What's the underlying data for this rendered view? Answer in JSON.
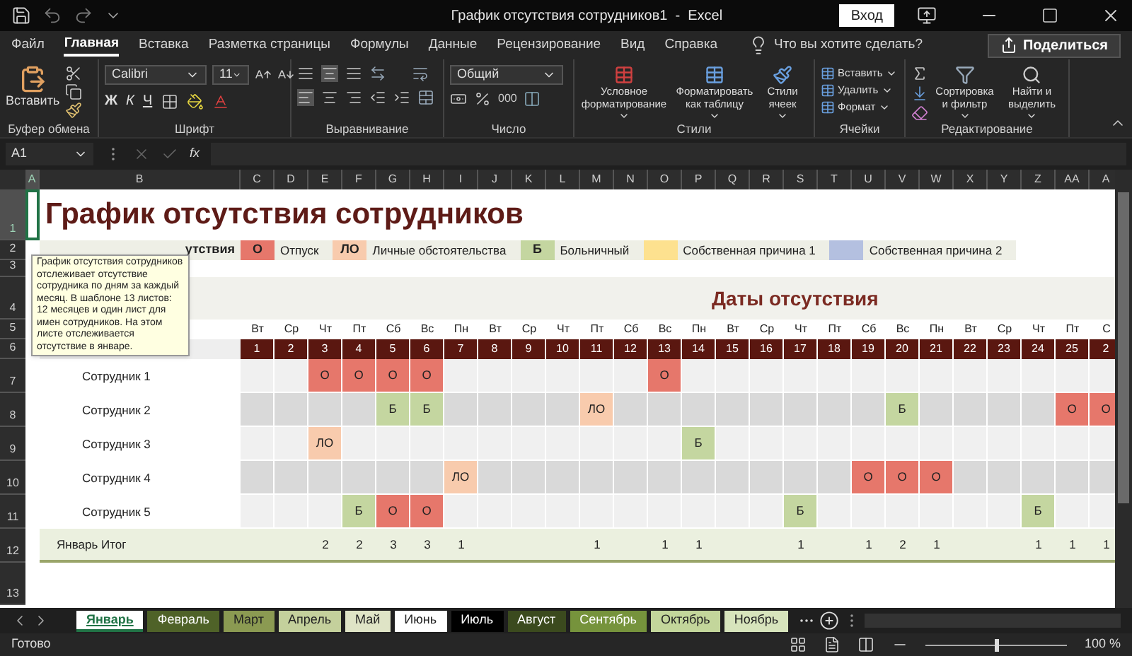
{
  "title_bar": {
    "title": "График отсутствия сотрудников1  -  Excel",
    "sign_in": "Вход"
  },
  "menu_tabs": [
    {
      "label": "Файл",
      "selected": false
    },
    {
      "label": "Главная",
      "selected": true
    },
    {
      "label": "Вставка",
      "selected": false
    },
    {
      "label": "Разметка страницы",
      "selected": false
    },
    {
      "label": "Формулы",
      "selected": false
    },
    {
      "label": "Данные",
      "selected": false
    },
    {
      "label": "Рецензирование",
      "selected": false
    },
    {
      "label": "Вид",
      "selected": false
    },
    {
      "label": "Справка",
      "selected": false
    }
  ],
  "tell_me": "Что вы хотите сделать?",
  "share": "Поделиться",
  "ribbon": {
    "clipboard": {
      "paste": "Вставить",
      "group": "Буфер обмена"
    },
    "font": {
      "name": "Calibri",
      "size": "11",
      "bold": "Ж",
      "italic": "К",
      "underline": "Ч",
      "group": "Шрифт"
    },
    "alignment": {
      "group": "Выравнивание"
    },
    "number": {
      "format": "Общий",
      "thousands": "000",
      "group": "Число"
    },
    "styles": {
      "buttons": [
        "Условное форматирование",
        "Форматировать как таблицу",
        "Стили ячеек"
      ],
      "group": "Стили"
    },
    "cells": {
      "buttons": [
        "Вставить",
        "Удалить",
        "Формат"
      ],
      "group": "Ячейки"
    },
    "editing": {
      "buttons": [
        "Сортировка и фильтр",
        "Найти и выделить"
      ],
      "group": "Редактирование"
    }
  },
  "formula_bar": {
    "cell": "A1",
    "function_label": "fx"
  },
  "columns": [
    "A",
    "B",
    "C",
    "D",
    "E",
    "F",
    "G",
    "H",
    "I",
    "J",
    "K",
    "L",
    "M",
    "N",
    "O",
    "P",
    "Q",
    "R",
    "S",
    "T",
    "U",
    "V",
    "W",
    "X",
    "Y",
    "Z",
    "AA",
    "A"
  ],
  "row_numbers": [
    "1",
    "2",
    "3",
    "4",
    "5",
    "6",
    "7",
    "8",
    "9",
    "10",
    "11",
    "12",
    "13"
  ],
  "sheet": {
    "title": "График отсутствия сотрудников",
    "legend_label": "утствия",
    "legend": [
      {
        "code": "О",
        "label": "Отпуск",
        "kind": "vacation",
        "color": "#e6776b"
      },
      {
        "code": "ЛО",
        "label": "Личные обстоятельства",
        "kind": "personal",
        "color": "#f8cbad"
      },
      {
        "code": "Б",
        "label": "Больничный",
        "kind": "sick",
        "color": "#c4d6a0"
      },
      {
        "label": "Собственная причина 1",
        "kind": "own1",
        "color": "#fde18f"
      },
      {
        "label": "Собственная причина 2",
        "kind": "own2",
        "color": "#b4c0e0"
      }
    ],
    "dates_heading": "Даты отсутствия",
    "days": [
      {
        "name": "Вт",
        "number": "1"
      },
      {
        "name": "Ср",
        "number": "2"
      },
      {
        "name": "Чт",
        "number": "3"
      },
      {
        "name": "Пт",
        "number": "4"
      },
      {
        "name": "Сб",
        "number": "5"
      },
      {
        "name": "Вс",
        "number": "6"
      },
      {
        "name": "Пн",
        "number": "7"
      },
      {
        "name": "Вт",
        "number": "8"
      },
      {
        "name": "Ср",
        "number": "9"
      },
      {
        "name": "Чт",
        "number": "10"
      },
      {
        "name": "Пт",
        "number": "11"
      },
      {
        "name": "Сб",
        "number": "12"
      },
      {
        "name": "Вс",
        "number": "13"
      },
      {
        "name": "Пн",
        "number": "14"
      },
      {
        "name": "Вт",
        "number": "15"
      },
      {
        "name": "Ср",
        "number": "16"
      },
      {
        "name": "Чт",
        "number": "17"
      },
      {
        "name": "Пт",
        "number": "18"
      },
      {
        "name": "Сб",
        "number": "19"
      },
      {
        "name": "Вс",
        "number": "20"
      },
      {
        "name": "Пн",
        "number": "21"
      },
      {
        "name": "Вт",
        "number": "22"
      },
      {
        "name": "Ср",
        "number": "23"
      },
      {
        "name": "Чт",
        "number": "24"
      },
      {
        "name": "Пт",
        "number": "25"
      },
      {
        "name": "С",
        "number": "2"
      }
    ],
    "employees": [
      {
        "name": "Сотрудник 1",
        "cells": [
          null,
          null,
          {
            "kind": "vacation",
            "text": "О"
          },
          {
            "kind": "vacation",
            "text": "О"
          },
          {
            "kind": "vacation",
            "text": "О"
          },
          {
            "kind": "vacation",
            "text": "О"
          },
          null,
          null,
          null,
          null,
          null,
          null,
          {
            "kind": "vacation",
            "text": "О"
          },
          null,
          null,
          null,
          null,
          null,
          null,
          null,
          null,
          null,
          null,
          null,
          null,
          null
        ]
      },
      {
        "name": "Сотрудник 2",
        "cells": [
          null,
          null,
          null,
          null,
          {
            "kind": "sick",
            "text": "Б"
          },
          {
            "kind": "sick",
            "text": "Б"
          },
          null,
          null,
          null,
          null,
          {
            "kind": "personal",
            "text": "ЛО"
          },
          null,
          null,
          null,
          null,
          null,
          null,
          null,
          null,
          {
            "kind": "sick",
            "text": "Б"
          },
          null,
          null,
          null,
          null,
          {
            "kind": "vacation",
            "text": "О"
          },
          {
            "kind": "vacation",
            "text": "О"
          }
        ]
      },
      {
        "name": "Сотрудник 3",
        "cells": [
          null,
          null,
          {
            "kind": "personal",
            "text": "ЛО"
          },
          null,
          null,
          null,
          null,
          null,
          null,
          null,
          null,
          null,
          null,
          {
            "kind": "sick",
            "text": "Б"
          },
          null,
          null,
          null,
          null,
          null,
          null,
          null,
          null,
          null,
          null,
          null,
          null
        ]
      },
      {
        "name": "Сотрудник 4",
        "cells": [
          null,
          null,
          null,
          null,
          null,
          null,
          {
            "kind": "personal",
            "text": "ЛО"
          },
          null,
          null,
          null,
          null,
          null,
          null,
          null,
          null,
          null,
          null,
          null,
          {
            "kind": "vacation",
            "text": "О"
          },
          {
            "kind": "vacation",
            "text": "О"
          },
          {
            "kind": "vacation",
            "text": "О"
          },
          null,
          null,
          null,
          null,
          null
        ]
      },
      {
        "name": "Сотрудник 5",
        "cells": [
          null,
          null,
          null,
          {
            "kind": "sick",
            "text": "Б"
          },
          {
            "kind": "vacation",
            "text": "О"
          },
          {
            "kind": "vacation",
            "text": "О"
          },
          null,
          null,
          null,
          null,
          null,
          null,
          null,
          null,
          null,
          null,
          {
            "kind": "sick",
            "text": "Б"
          },
          null,
          null,
          null,
          null,
          null,
          null,
          {
            "kind": "sick",
            "text": "Б"
          },
          null,
          null
        ]
      }
    ],
    "total": {
      "label": "Январь Итог",
      "values": [
        {
          "kind": "empty"
        },
        {
          "kind": "empty"
        },
        {
          "kind": "count",
          "text": "2"
        },
        {
          "kind": "count",
          "text": "2"
        },
        {
          "kind": "count",
          "text": "3"
        },
        {
          "kind": "count",
          "text": "3"
        },
        {
          "kind": "count",
          "text": "1"
        },
        {
          "kind": "empty"
        },
        {
          "kind": "empty"
        },
        {
          "kind": "empty"
        },
        {
          "kind": "count",
          "text": "1"
        },
        {
          "kind": "empty"
        },
        {
          "kind": "count",
          "text": "1"
        },
        {
          "kind": "count",
          "text": "1"
        },
        {
          "kind": "empty"
        },
        {
          "kind": "empty"
        },
        {
          "kind": "count",
          "text": "1"
        },
        {
          "kind": "empty"
        },
        {
          "kind": "count",
          "text": "1"
        },
        {
          "kind": "count",
          "text": "2"
        },
        {
          "kind": "count",
          "text": "1"
        },
        {
          "kind": "empty"
        },
        {
          "kind": "empty"
        },
        {
          "kind": "count",
          "text": "1"
        },
        {
          "kind": "count",
          "text": "1"
        },
        {
          "kind": "count",
          "text": "1"
        }
      ]
    }
  },
  "comment": "График отсутствия сотрудников отслеживает отсутствие сотрудника по дням за каждый месяц. В шаблоне 13 листов: 12 месяцев и один лист для имен сотрудников. На этом листе отслеживается отсутствие в январе.",
  "sheet_tabs": [
    {
      "name": "Январь",
      "color": "#ffffff",
      "selected": true
    },
    {
      "name": "Февраль",
      "color": "#4f6228",
      "selected": false
    },
    {
      "name": "Март",
      "color": "#8b9a52",
      "selected": false
    },
    {
      "name": "Апрель",
      "color": "#c4d09c",
      "selected": false
    },
    {
      "name": "Май",
      "color": "#dfe4c6",
      "selected": false
    },
    {
      "name": "Июнь",
      "color": "#ffffff",
      "selected": false
    },
    {
      "name": "Июль",
      "color": "#000000",
      "selected": false
    },
    {
      "name": "Август",
      "color": "#3b4a1e",
      "selected": false
    },
    {
      "name": "Сентябрь",
      "color": "#76933c",
      "selected": false
    },
    {
      "name": "Октябрь",
      "color": "#c3d69b",
      "selected": false
    },
    {
      "name": "Ноябрь",
      "color": "#d7e4bc",
      "selected": false
    }
  ],
  "status": "Готово",
  "zoom": {
    "level": 0.5,
    "reading": "100 %"
  }
}
